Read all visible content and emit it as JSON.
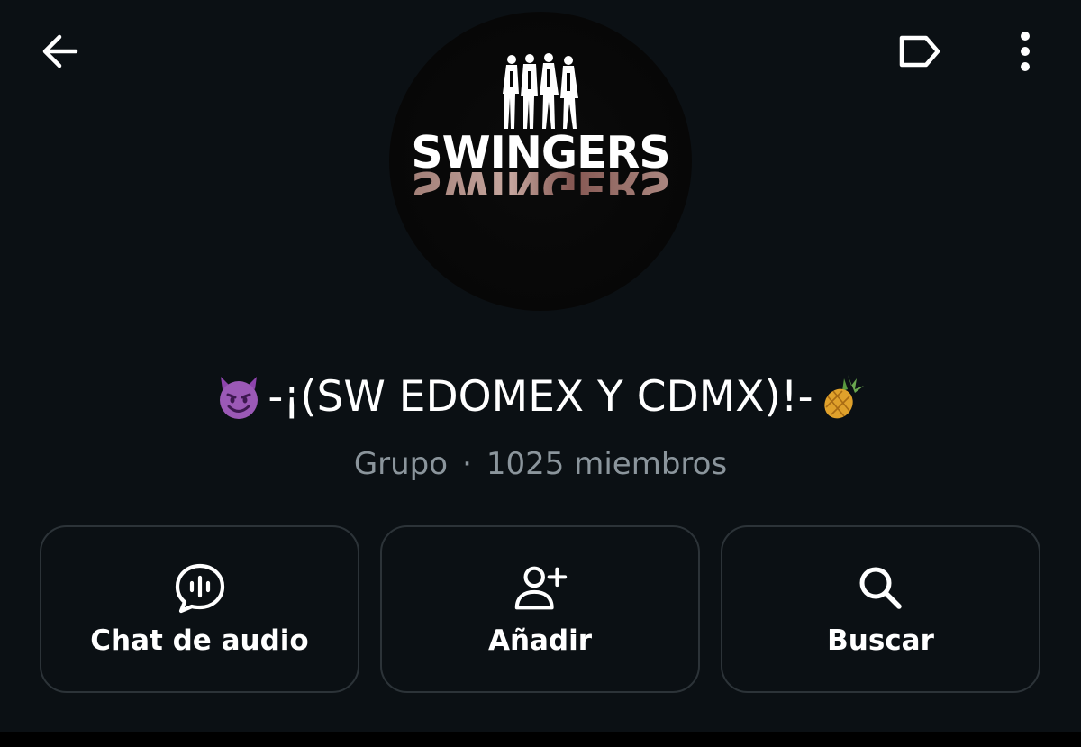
{
  "header": {
    "back_icon": "arrow-left-icon",
    "label_icon": "label-tag-icon",
    "more_icon": "more-vertical-icon"
  },
  "avatar": {
    "logo_text": "SWINGERS"
  },
  "group": {
    "title_prefix_emoji": "smiling-face-with-horns",
    "title": "-¡(SW EDOMEX Y CDMX)!-",
    "title_suffix_emoji": "pineapple",
    "type": "Grupo",
    "separator": "·",
    "members": "1025 miembros"
  },
  "actions": [
    {
      "label": "Chat de audio",
      "icon": "audio-chat-icon"
    },
    {
      "label": "Añadir",
      "icon": "add-person-icon"
    },
    {
      "label": "Buscar",
      "icon": "search-icon"
    }
  ],
  "colors": {
    "background": "#0b1014",
    "card_border": "#2c3338",
    "subtitle": "#8b959c",
    "text": "#ffffff"
  }
}
